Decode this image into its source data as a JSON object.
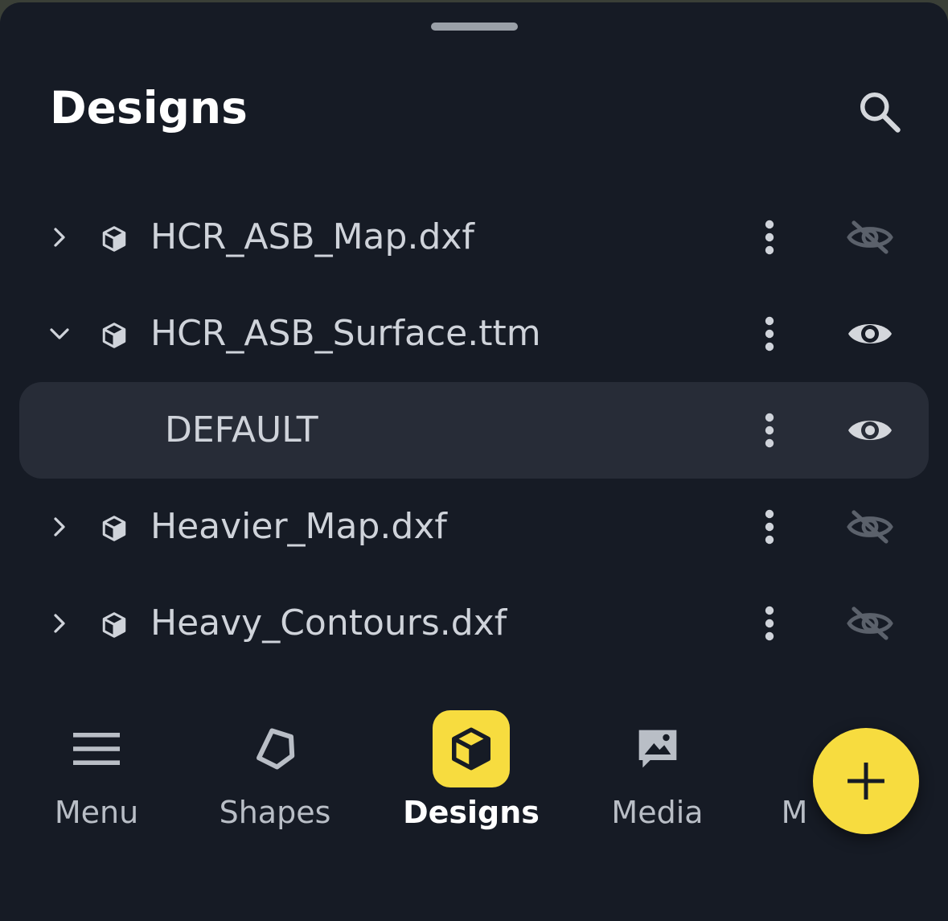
{
  "header": {
    "title": "Designs"
  },
  "designs": [
    {
      "name": "HCR_ASB_Map.dxf",
      "expanded": false,
      "visible": false,
      "level": 0
    },
    {
      "name": "HCR_ASB_Surface.ttm",
      "expanded": true,
      "visible": true,
      "level": 0
    },
    {
      "name": "DEFAULT",
      "visible": true,
      "level": 1,
      "selected": true
    },
    {
      "name": "Heavier_Map.dxf",
      "expanded": false,
      "visible": false,
      "level": 0
    },
    {
      "name": "Heavy_Contours.dxf",
      "expanded": false,
      "visible": false,
      "level": 0
    }
  ],
  "nav": {
    "items": [
      {
        "label": "Menu",
        "icon": "hamburger-icon"
      },
      {
        "label": "Shapes",
        "icon": "pentagon-icon"
      },
      {
        "label": "Designs",
        "icon": "cube-icon",
        "active": true
      },
      {
        "label": "Media",
        "icon": "image-icon"
      },
      {
        "label": "M",
        "icon": "",
        "clipped": true
      }
    ]
  },
  "fab": {
    "icon": "plus-icon"
  },
  "colors": {
    "background": "#161b25",
    "selected_row": "#272c37",
    "accent": "#f7dc3f",
    "text": "#cfd3da",
    "icon_dim": "#5b616b"
  }
}
